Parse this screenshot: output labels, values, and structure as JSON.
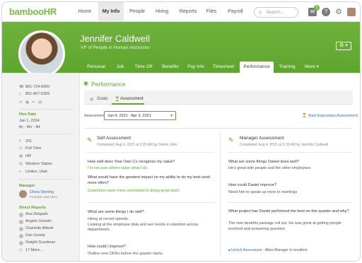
{
  "topnav": {
    "logo_text": "bambooHR",
    "items": [
      "Home",
      "My Info",
      "People",
      "Hiring",
      "Reports",
      "Files",
      "Payroll"
    ],
    "active": "My Info",
    "search_placeholder": "Search...",
    "notification_count": "1",
    "help_symbol": "?"
  },
  "profile": {
    "name": "Jennifer Caldwell",
    "title": "VP of People in Human resources",
    "tabs": [
      "Personal",
      "Job",
      "Time Off",
      "Benefits",
      "Pay Info",
      "Timesheet",
      "Performance",
      "Training",
      "More ▾"
    ],
    "active_tab": "Performance",
    "settings_symbol": "⚙ ▾"
  },
  "sidebar": {
    "phone_work": "801-724-6600",
    "phone_mobile": "801-867-5309",
    "hire_date_label": "Hire Date",
    "hire_date": "Jan 1, 2014",
    "tenure": "8y - 8m - 4d",
    "employee_no": "201",
    "employment_type": "Full Time",
    "department": "HR",
    "region": "Western States",
    "location": "Lindon, Utah",
    "manager_label": "Manager",
    "manager_name": "Olivia Sterling",
    "manager_title": "Founder and CEO",
    "reports_label": "Direct Reports",
    "reports": [
      "Ana Delgado",
      "Angelo Gosslin",
      "Charlotte Abbott",
      "Dan Greely",
      "Dwight Goodman"
    ],
    "more_reports": "17 More..."
  },
  "performance": {
    "title": "Performance",
    "subtabs": [
      "Goals",
      "Assessment"
    ],
    "active_subtab": "Assessment",
    "assessments_label": "Assessments",
    "assessment_period": "Jan 4, 2021 - Apr 3, 2021",
    "start_link": "Start Impromptu Assessment",
    "self": {
      "title": "Self Assessment",
      "completed": "Completed: Aug 4, 2021 at 9:15 AM by Daniel John",
      "q1": "How well does Your Own Co recognize my value?",
      "a1": "I'm not sure others value what I do.",
      "q2": "What would have the greatest impact on my ability to do my best work more often?",
      "a2": "Coworkers were more committed to doing great work.",
      "q3": "What are some things I do well?",
      "a3": "Hiring at record speeds.\nLooking at the employee data and see trends in retention across departments.",
      "q4": "How could I improve?",
      "a4": "Outline new OKRs before the quarter starts."
    },
    "manager": {
      "title": "Manager Assessment",
      "completed": "Completed: Aug 4, 2021 at 9:15 AM by Jennifer Caldwell",
      "q1": "What are some things Daniel does well?",
      "a1": "He's great with people and the other employees",
      "q2": "How could Daniel improve?",
      "a2": "Need him to speak up more in meetings",
      "q3": "What project has Daniel performed the best on this quarter and why?",
      "a3": "The new benefits package roll out. He was great at getting people involved and answering question",
      "unlock_link": "Unlock Assessment",
      "unlock_text": "- Allow Manager to resubmit"
    }
  },
  "colors": {
    "brand_green": "#5ea52f",
    "link_blue": "#3a6fb0"
  }
}
